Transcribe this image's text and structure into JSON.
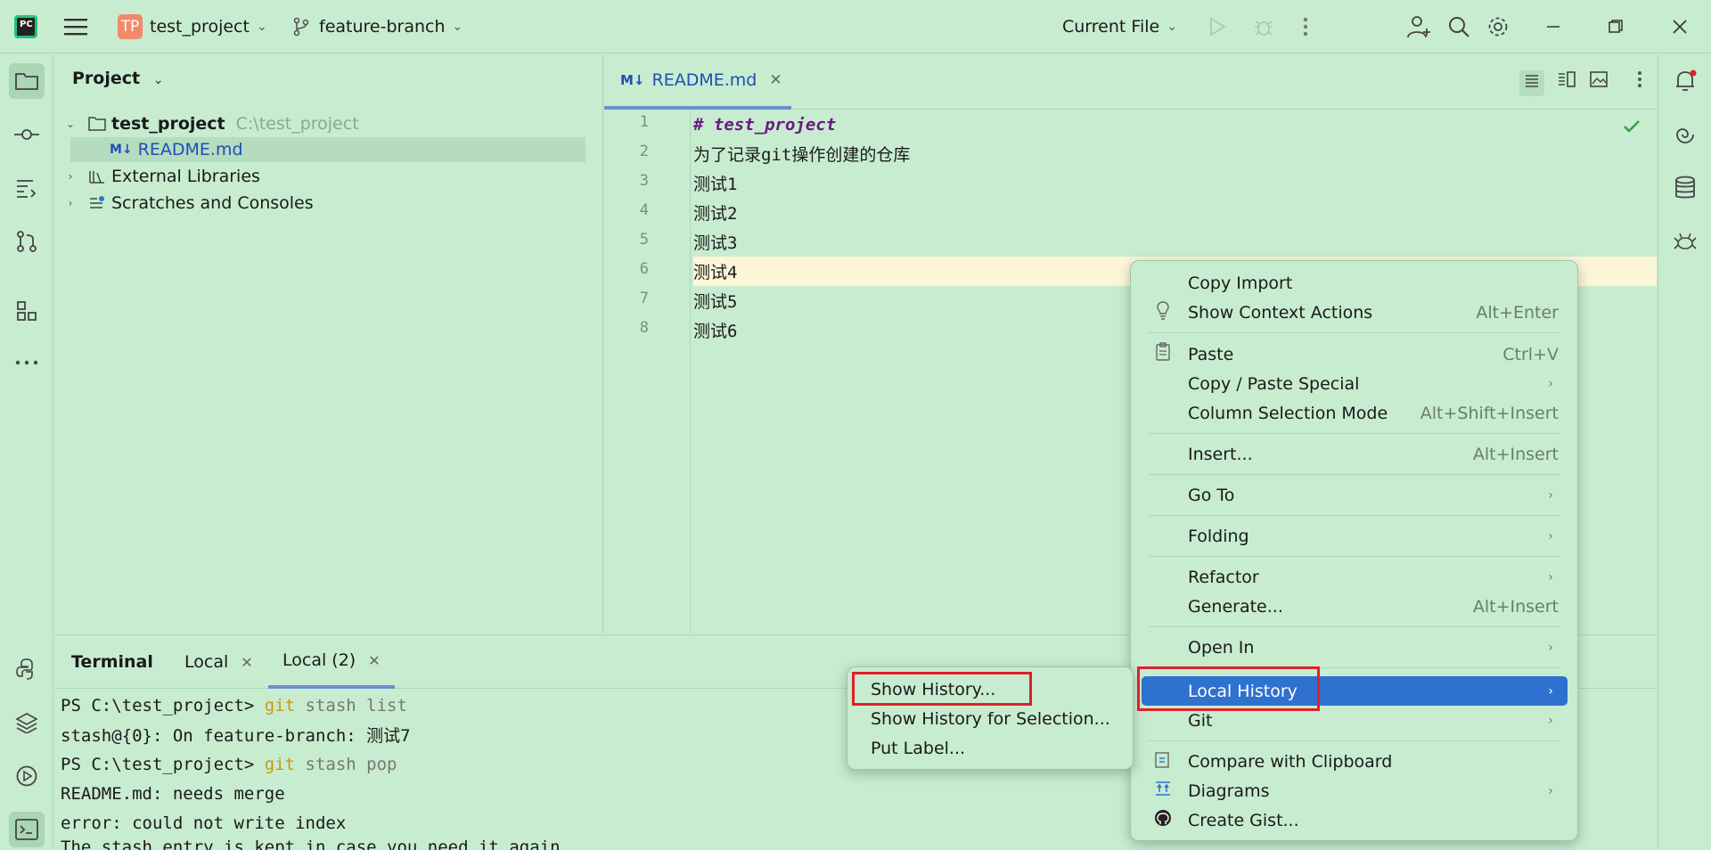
{
  "titlebar": {
    "logo_text": "PC",
    "project_initials": "TP",
    "project_name": "test_project",
    "branch_name": "feature-branch",
    "run_config": "Current File"
  },
  "project_panel": {
    "header": "Project",
    "tree": [
      {
        "label": "test_project",
        "path": "C:\\test_project",
        "expanded": true
      },
      {
        "label": "README.md",
        "selected": true
      },
      {
        "label": "External Libraries",
        "expanded": false
      },
      {
        "label": "Scratches and Consoles",
        "expanded": false
      }
    ]
  },
  "editor": {
    "tab_label": "README.md",
    "tab_badge": "M↓",
    "lines": [
      {
        "no": "1",
        "text": "# test_project"
      },
      {
        "no": "2",
        "text": "为了记录git操作创建的仓库"
      },
      {
        "no": "3",
        "text": "测试1"
      },
      {
        "no": "4",
        "text": "测试2"
      },
      {
        "no": "5",
        "text": "测试3"
      },
      {
        "no": "6",
        "text": "测试4"
      },
      {
        "no": "7",
        "text": "测试5"
      },
      {
        "no": "8",
        "text": "测试6"
      }
    ]
  },
  "terminal": {
    "title": "Terminal",
    "tabs": [
      "Local",
      "Local (2)"
    ],
    "lines": [
      {
        "prompt": "PS C:\\test_project> ",
        "cmd": "git",
        "rest": " stash list"
      },
      {
        "text": "stash@{0}: On feature-branch: 测试7"
      },
      {
        "prompt": "PS C:\\test_project> ",
        "cmd": "git",
        "rest": " stash pop"
      },
      {
        "text": "README.md: needs merge"
      },
      {
        "text": "error: could not write index"
      },
      {
        "text": "The stash entry is kept in case you need it again."
      }
    ]
  },
  "context_menu": {
    "copy_import": "Copy Import",
    "show_context_actions": "Show Context Actions",
    "show_context_actions_sc": "Alt+Enter",
    "paste": "Paste",
    "paste_sc": "Ctrl+V",
    "copy_paste_special": "Copy / Paste Special",
    "column_selection_mode": "Column Selection Mode",
    "column_selection_mode_sc": "Alt+Shift+Insert",
    "insert": "Insert...",
    "insert_sc": "Alt+Insert",
    "go_to": "Go To",
    "folding": "Folding",
    "refactor": "Refactor",
    "generate": "Generate...",
    "generate_sc": "Alt+Insert",
    "open_in": "Open In",
    "local_history": "Local History",
    "git": "Git",
    "compare_clipboard": "Compare with Clipboard",
    "diagrams": "Diagrams",
    "create_gist": "Create Gist..."
  },
  "submenu": {
    "show_history": "Show History...",
    "show_history_selection": "Show History for Selection...",
    "put_label": "Put Label..."
  },
  "colors": {
    "background": "#c8ecd0",
    "highlight": "#2f71cf",
    "annotation_red": "#e0202a"
  }
}
